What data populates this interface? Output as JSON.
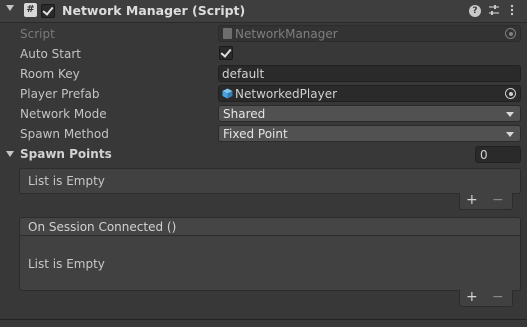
{
  "header": {
    "title": "Network Manager (Script)",
    "enabled": true
  },
  "fields": {
    "script": {
      "label": "Script",
      "value": "NetworkManager"
    },
    "auto_start": {
      "label": "Auto Start",
      "checked": true
    },
    "room_key": {
      "label": "Room Key",
      "value": "default"
    },
    "player_prefab": {
      "label": "Player Prefab",
      "value": "NetworkedPlayer"
    },
    "network_mode": {
      "label": "Network Mode",
      "value": "Shared"
    },
    "spawn_method": {
      "label": "Spawn Method",
      "value": "Fixed Point"
    }
  },
  "spawn_points": {
    "label": "Spawn Points",
    "count": "0",
    "empty_text": "List is Empty"
  },
  "event": {
    "title": "On Session Connected ()",
    "empty_text": "List is Empty"
  },
  "buttons": {
    "add": "+",
    "remove": "−"
  },
  "icons": {
    "header_fold": "triangle-down-icon",
    "script": "script-hash-icon",
    "help": "help-icon",
    "presets": "sliders-icon",
    "more": "kebab-menu-icon",
    "script_asset": "script-file-icon",
    "prefab": "prefab-cube-icon",
    "object_picker": "object-picker-icon"
  },
  "colors": {
    "prefab_icon": "#4aa3df",
    "panel_bg": "#383838",
    "field_bg": "#2a2a2a"
  }
}
